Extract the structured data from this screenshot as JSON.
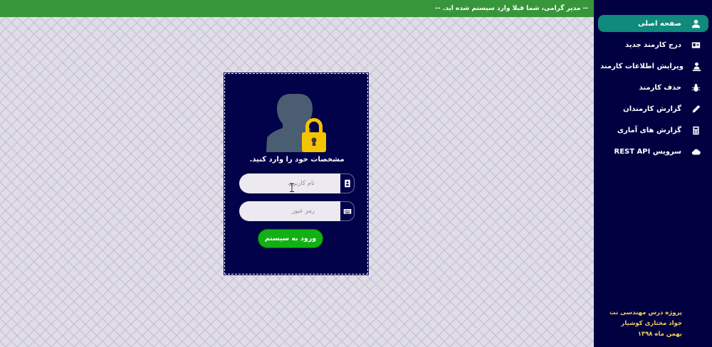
{
  "topbar": {
    "message": "-- مدیر گرامی، شما قبلا وارد سیستم شده اید. --"
  },
  "sidebar": {
    "items": [
      {
        "label": "صفحه اصلی",
        "icon": "user-icon",
        "active": true
      },
      {
        "label": "درج کارمند جدید",
        "icon": "id-card-icon",
        "active": false
      },
      {
        "label": "ویرایش اطلاعات کارمند",
        "icon": "user-edit-icon",
        "active": false
      },
      {
        "label": "حذف کارمند",
        "icon": "bug-icon",
        "active": false
      },
      {
        "label": "گزارش کارمندان",
        "icon": "pen-icon",
        "active": false
      },
      {
        "label": "گزارش های آماری",
        "icon": "calculator-icon",
        "active": false
      },
      {
        "label": "سرویس REST API",
        "icon": "cloud-icon",
        "active": false
      }
    ],
    "credits": {
      "line1": "پروژه درس مهندسی نت",
      "line2": "جواد مختاری کوشیار",
      "line3": "بهمن ماه ۱۳۹۸"
    }
  },
  "login": {
    "title": "مشخصات خود را وارد کنید.",
    "username_placeholder": "نام کاربری",
    "password_placeholder": "رمز عبور",
    "submit_label": "ورود به سیستم"
  },
  "colors": {
    "topbar": "#37963a",
    "sidebar": "#010142",
    "active_item": "#0f8a7c",
    "card": "#02024a",
    "button": "#12b012",
    "credits": "#f3d25a"
  }
}
